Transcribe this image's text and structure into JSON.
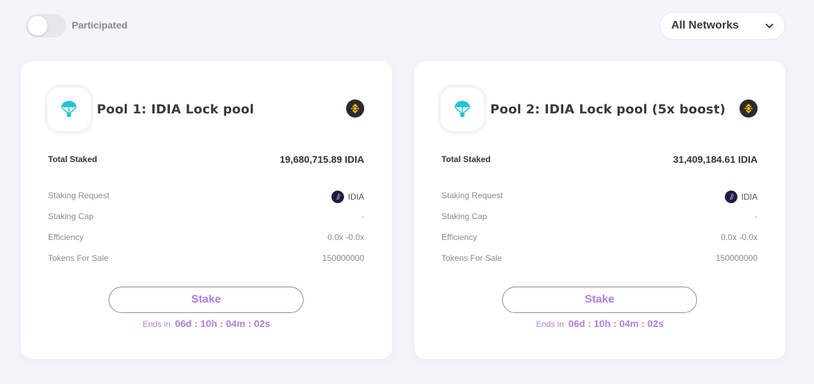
{
  "filter": {
    "participated_label": "Participated",
    "participated_on": false,
    "network_selected": "All Networks"
  },
  "colors": {
    "accent": "#b07fd8",
    "pool_icon": "#23c4d6",
    "binance": "#f0b90b"
  },
  "pools": [
    {
      "title": "Pool 1: IDIA Lock pool",
      "icon": "parachute-icon",
      "chain_icon": "binance-icon",
      "total_staked_label": "Total Staked",
      "total_staked_value": "19,680,715.89 IDIA",
      "staking_request_label": "Staking Request",
      "staking_request_token": "IDIA",
      "staking_cap_label": "Staking Cap",
      "staking_cap_value": "-",
      "efficiency_label": "Efficiency",
      "efficiency_value": "0.0x -0.0x",
      "tokens_for_sale_label": "Tokens For Sale",
      "tokens_for_sale_value": "150000000",
      "stake_label": "Stake",
      "ends_label": "Ends in",
      "ends_time": "06d : 10h : 04m : 02s"
    },
    {
      "title": "Pool 2: IDIA Lock pool (5x boost)",
      "icon": "parachute-icon",
      "chain_icon": "binance-icon",
      "total_staked_label": "Total Staked",
      "total_staked_value": "31,409,184.61 IDIA",
      "staking_request_label": "Staking Request",
      "staking_request_token": "IDIA",
      "staking_cap_label": "Staking Cap",
      "staking_cap_value": "-",
      "efficiency_label": "Efficiency",
      "efficiency_value": "0.0x -0.0x",
      "tokens_for_sale_label": "Tokens For Sale",
      "tokens_for_sale_value": "150000000",
      "stake_label": "Stake",
      "ends_label": "Ends in",
      "ends_time": "06d : 10h : 04m : 02s"
    }
  ]
}
